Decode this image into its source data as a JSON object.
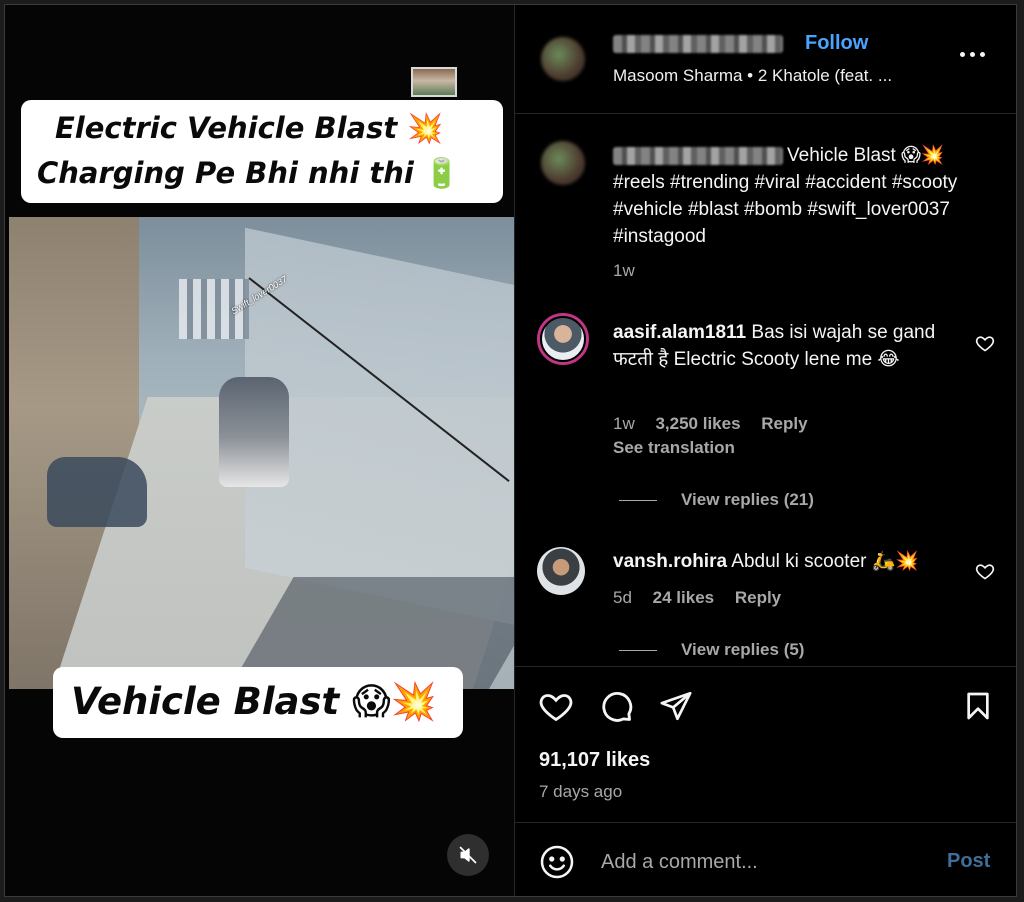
{
  "reel": {
    "caption_top_line1": "Electric Vehicle Blast",
    "caption_top_line1_emoji": "💥",
    "caption_top_line2": "Charging Pe Bhi nhi thi",
    "caption_top_line2_emoji": "🔋",
    "caption_bottom": "Vehicle Blast",
    "caption_bottom_emoji": "😱💥",
    "watermark": "Swift_lover0037",
    "mute_icon": "speaker-muted-icon"
  },
  "header": {
    "follow_label": "Follow",
    "audio_artist": "Masoom Sharma",
    "audio_separator": "•",
    "audio_track": "2 Khatole (feat. ...",
    "more_icon": "more-horizontal-icon"
  },
  "post_caption": {
    "text": "Vehicle Blast 😱💥",
    "hashtags": "#reels #trending #viral #accident #scooty #vehicle #blast #bomb #swift_lover0037 #instagood",
    "time": "1w"
  },
  "comments": [
    {
      "username": "aasif.alam1811",
      "text": "Bas isi wajah se gand फटती है Electric Scooty lene me 😂",
      "time": "1w",
      "likes": "3,250 likes",
      "reply_label": "Reply",
      "see_translation": "See translation",
      "view_replies": "View replies (21)"
    },
    {
      "username": "vansh.rohira",
      "text": "Abdul ki scooter 🛵💥",
      "time": "5d",
      "likes": "24 likes",
      "reply_label": "Reply",
      "view_replies": "View replies (5)"
    }
  ],
  "actions": {
    "icons": [
      "heart-icon",
      "comment-icon",
      "share-icon",
      "bookmark-icon"
    ],
    "likes": "91,107 likes",
    "date": "7 days ago"
  },
  "add_comment": {
    "placeholder": "Add a comment...",
    "post_label": "Post"
  },
  "colors": {
    "accent_blue": "#4aa3ff",
    "post_disabled": "#3d6f99",
    "muted_text": "#a8a8a8",
    "background": "#000000"
  }
}
